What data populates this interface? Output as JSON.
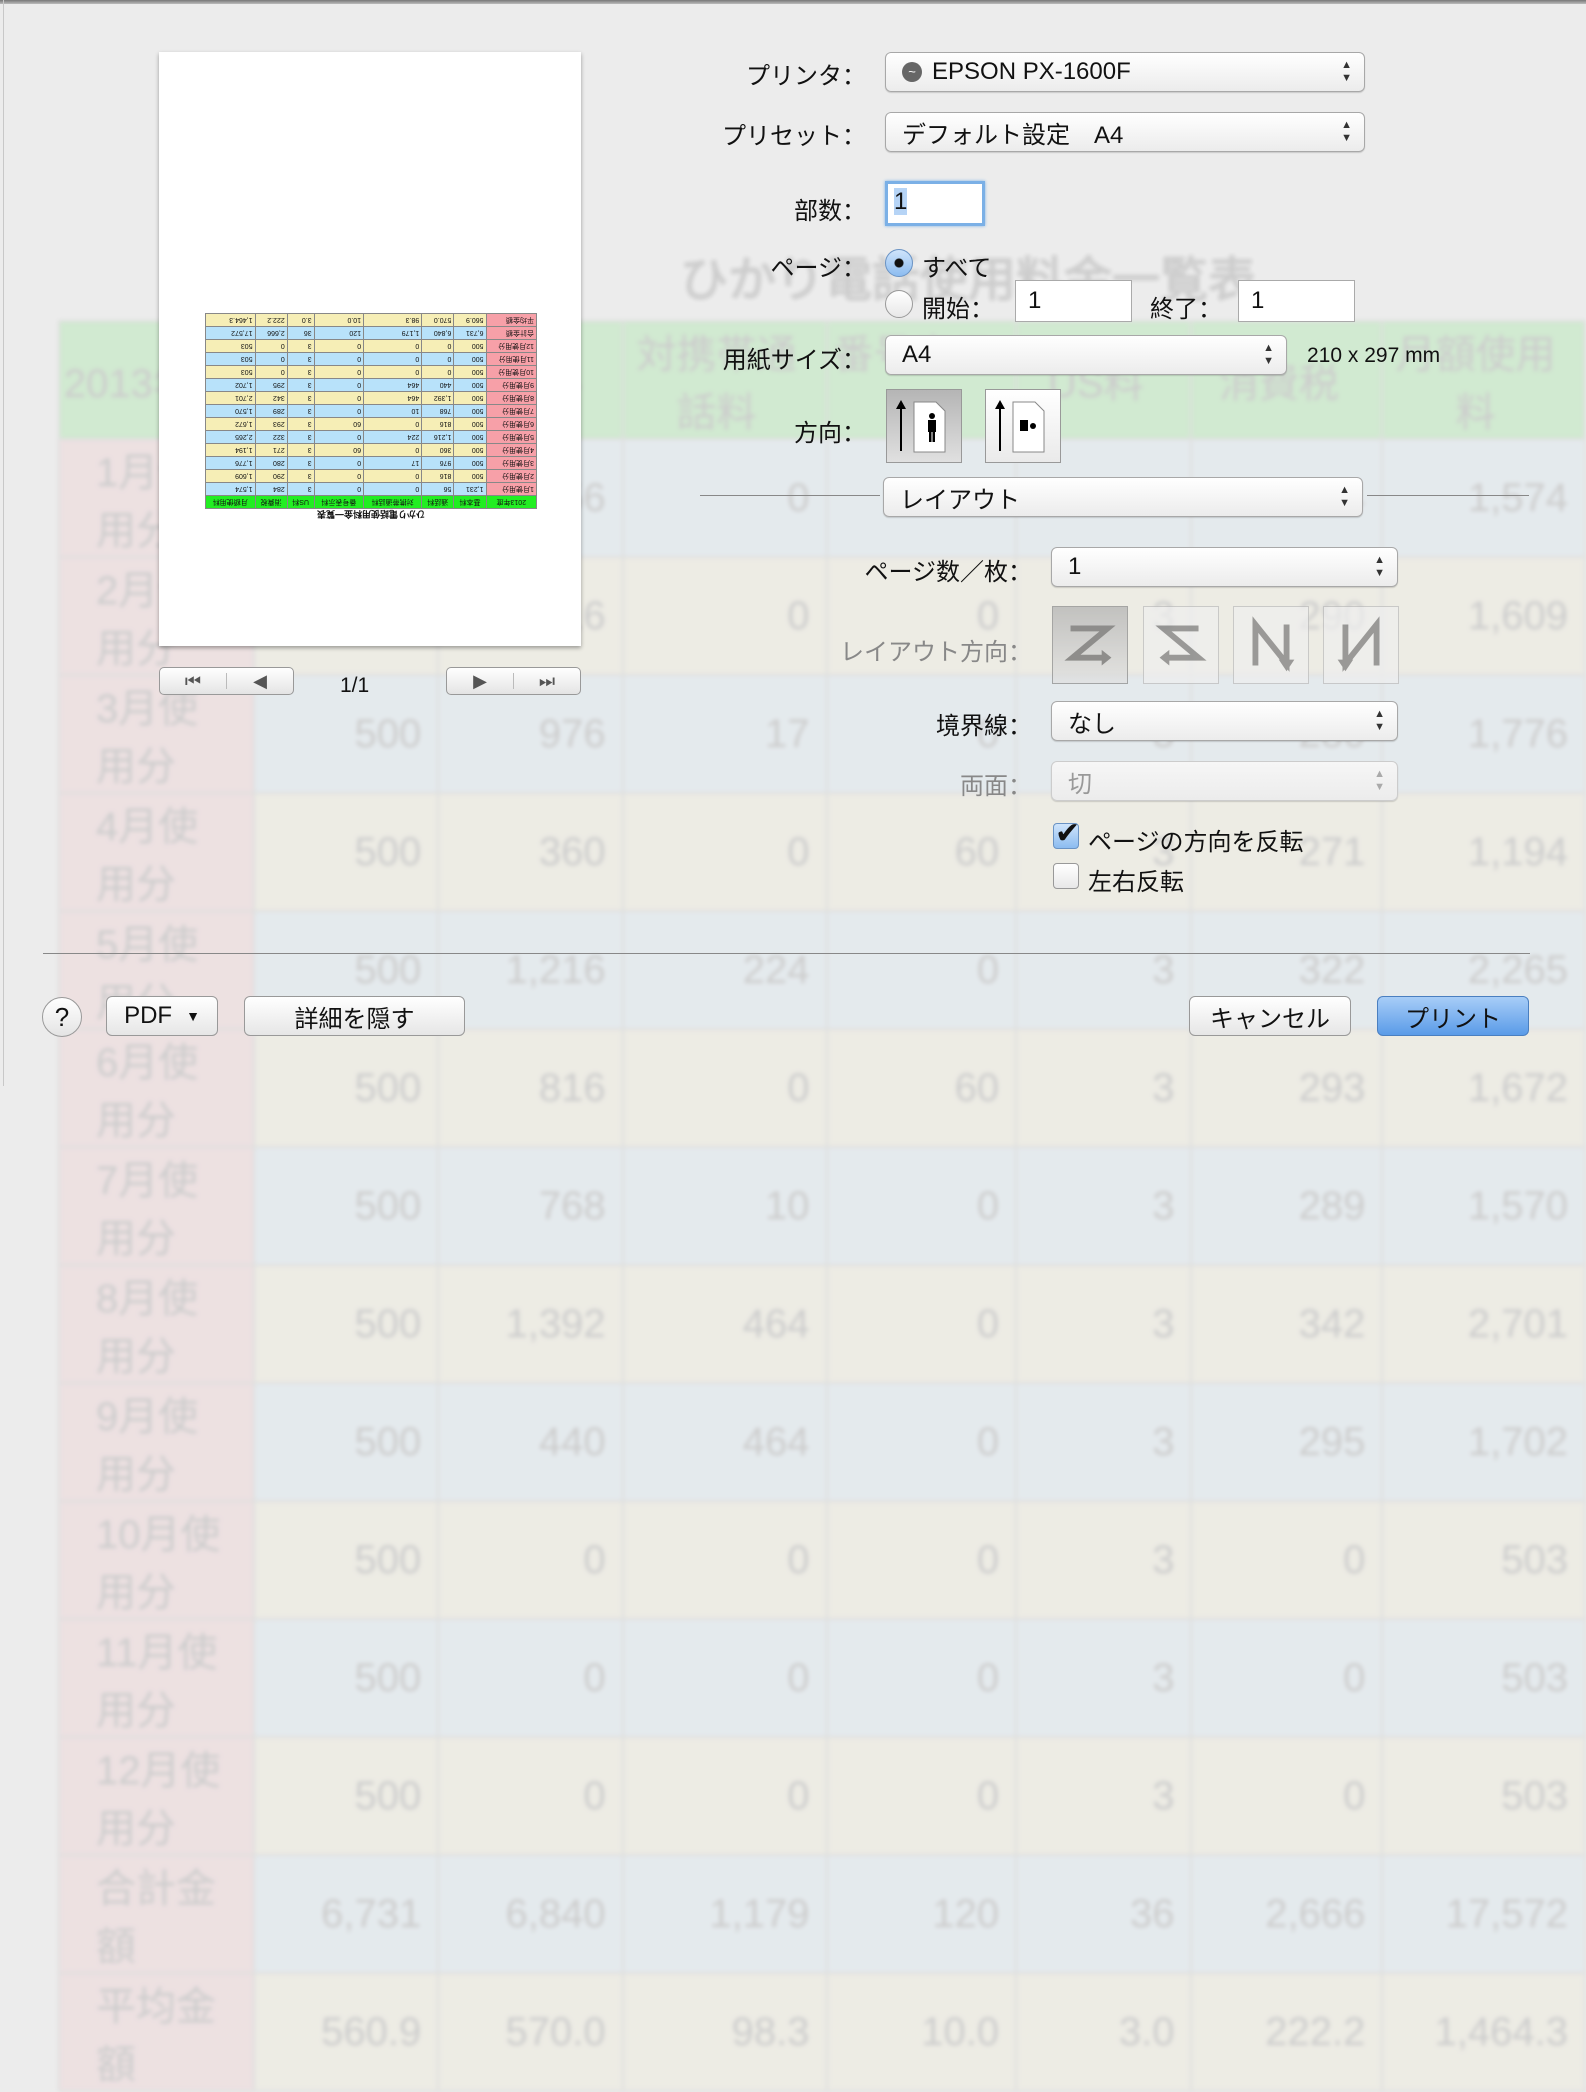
{
  "background_sheet": {
    "title": "ひかり電話使用料金一覧表",
    "headers": [
      "2013年度",
      "基本料",
      "通話料",
      "対携帯通話料",
      "番号表示料",
      "US料",
      "消費税",
      "月額使用料"
    ],
    "rows": [
      [
        "1月使用分",
        "1,231",
        "56",
        "0",
        "0",
        "3",
        "284",
        "1,574"
      ],
      [
        "2月使用分",
        "500",
        "816",
        "0",
        "0",
        "3",
        "290",
        "1,609"
      ],
      [
        "3月使用分",
        "500",
        "976",
        "17",
        "0",
        "3",
        "280",
        "1,776"
      ],
      [
        "4月使用分",
        "500",
        "360",
        "0",
        "60",
        "3",
        "271",
        "1,194"
      ],
      [
        "5月使用分",
        "500",
        "1,216",
        "224",
        "0",
        "3",
        "322",
        "2,265"
      ],
      [
        "6月使用分",
        "500",
        "816",
        "0",
        "60",
        "3",
        "293",
        "1,672"
      ],
      [
        "7月使用分",
        "500",
        "768",
        "10",
        "0",
        "3",
        "289",
        "1,570"
      ],
      [
        "8月使用分",
        "500",
        "1,392",
        "464",
        "0",
        "3",
        "342",
        "2,701"
      ],
      [
        "9月使用分",
        "500",
        "440",
        "464",
        "0",
        "3",
        "295",
        "1,702"
      ],
      [
        "10月使用分",
        "500",
        "0",
        "0",
        "0",
        "3",
        "0",
        "503"
      ],
      [
        "11月使用分",
        "500",
        "0",
        "0",
        "0",
        "3",
        "0",
        "503"
      ],
      [
        "12月使用分",
        "500",
        "0",
        "0",
        "0",
        "3",
        "0",
        "503"
      ],
      [
        "合計金額",
        "6,731",
        "6,840",
        "1,179",
        "120",
        "36",
        "2,666",
        "17,572"
      ],
      [
        "平均金額",
        "560.9",
        "570.0",
        "98.3",
        "10.0",
        "3.0",
        "222.2",
        "1,464.3"
      ]
    ]
  },
  "preview": {
    "page_indicator": "1/1",
    "nav": {
      "first": "⏮",
      "prev": "◀",
      "next": "▶",
      "last": "⏭"
    }
  },
  "printer": {
    "label": "プリンタ：",
    "value": "EPSON PX-1600F"
  },
  "preset": {
    "label": "プリセット：",
    "value": "デフォルト設定　A4"
  },
  "copies": {
    "label": "部数：",
    "value": "1"
  },
  "pages": {
    "label": "ページ：",
    "all_label": "すべて",
    "from_label": "開始：",
    "from_value": "1",
    "to_label": "終了：",
    "to_value": "1",
    "selected": "all"
  },
  "paper": {
    "label": "用紙サイズ：",
    "value": "A4",
    "dimensions": "210 x 297 mm"
  },
  "orientation": {
    "label": "方向：",
    "selected": "portrait"
  },
  "section": {
    "value": "レイアウト"
  },
  "layout": {
    "pages_per_sheet": {
      "label": "ページ数／枚：",
      "value": "1"
    },
    "direction": {
      "label": "レイアウト方向：",
      "selected": 0
    },
    "border": {
      "label": "境界線：",
      "value": "なし"
    },
    "duplex": {
      "label": "両面：",
      "value": "切"
    },
    "reverse_orientation": {
      "label": "ページの方向を反転",
      "checked": true
    },
    "flip_horizontal": {
      "label": "左右反転",
      "checked": false
    }
  },
  "buttons": {
    "help": "?",
    "pdf": "PDF",
    "hide_details": "詳細を隠す",
    "cancel": "キャンセル",
    "print": "プリント"
  },
  "colors": {
    "accent": "#5a9be8",
    "header_green": "#22ee22",
    "label_pink": "#f7a0a8",
    "row_blue": "#b8e2fa",
    "row_yellow": "#f6eeb6"
  }
}
